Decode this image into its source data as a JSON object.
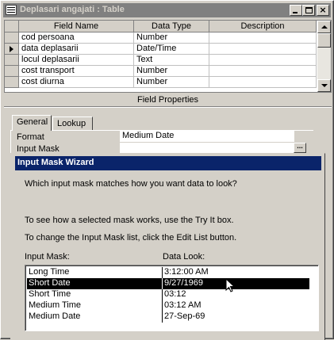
{
  "window": {
    "title": "Deplasari angajati : Table"
  },
  "grid": {
    "headers": [
      "Field Name",
      "Data Type",
      "Description"
    ],
    "rows": [
      {
        "name": "cod persoana",
        "type": "Number",
        "description": ""
      },
      {
        "name": "data deplasarii",
        "type": "Date/Time",
        "description": ""
      },
      {
        "name": "locul deplasarii",
        "type": "Text",
        "description": ""
      },
      {
        "name": "cost transport",
        "type": "Number",
        "description": ""
      },
      {
        "name": "cost diurna",
        "type": "Number",
        "description": ""
      }
    ],
    "current_row": 1
  },
  "field_properties": {
    "title": "Field Properties",
    "tabs": [
      "General",
      "Lookup"
    ],
    "active_tab": "General",
    "format_label": "Format",
    "format_value": "Medium Date",
    "input_mask_label": "Input Mask",
    "input_mask_value": "",
    "build_button": "..."
  },
  "wizard": {
    "title": "Input Mask Wizard",
    "question": "Which input mask matches how you want data to look?",
    "try_hint": "To see how a selected mask works, use the Try It box.",
    "edit_hint": "To change the Input Mask list, click the Edit List button.",
    "col_mask": "Input Mask:",
    "col_look": "Data Look:",
    "options": [
      {
        "mask": "Long Time",
        "look": "3:12:00 AM"
      },
      {
        "mask": "Short Date",
        "look": "9/27/1969"
      },
      {
        "mask": "Short Time",
        "look": "03:12"
      },
      {
        "mask": "Medium Time",
        "look": "03:12 AM"
      },
      {
        "mask": "Medium Date",
        "look": "27-Sep-69"
      }
    ],
    "selected_index": 1
  },
  "colors": {
    "inactive_title": "#808080",
    "active_title": "#0a246a",
    "selection": "#000000",
    "face": "#d4d0c8"
  }
}
